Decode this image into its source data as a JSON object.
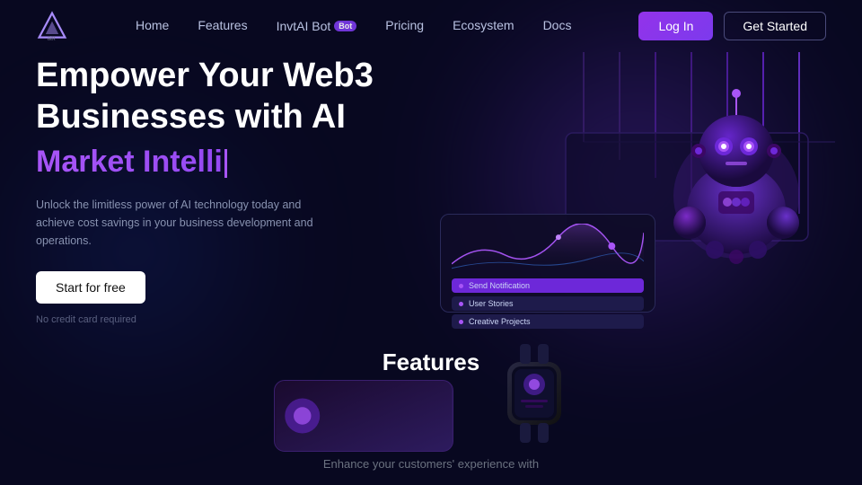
{
  "nav": {
    "logo_text": "AI",
    "links": [
      {
        "id": "home",
        "label": "Home"
      },
      {
        "id": "features",
        "label": "Features"
      },
      {
        "id": "invtai-bot",
        "label": "InvtAI Bot",
        "badge": "Bot"
      },
      {
        "id": "pricing",
        "label": "Pricing"
      },
      {
        "id": "ecosystem",
        "label": "Ecosystem"
      },
      {
        "id": "docs",
        "label": "Docs"
      }
    ],
    "login_label": "Log In",
    "started_label": "Get Started"
  },
  "hero": {
    "title_line1": "Empower Your Web3",
    "title_line2": "Businesses with AI",
    "typed_text": "Market Intelli",
    "description": "Unlock the limitless power of AI technology today and achieve cost savings in your business development and operations.",
    "cta_label": "Start for free",
    "no_credit": "No credit card required"
  },
  "dashboard": {
    "notif1": "Send Notification",
    "notif2": "User Stories",
    "notif3": "Creative Projects"
  },
  "features": {
    "title": "Features",
    "subtitle": "Enhance your customers' experience with"
  }
}
